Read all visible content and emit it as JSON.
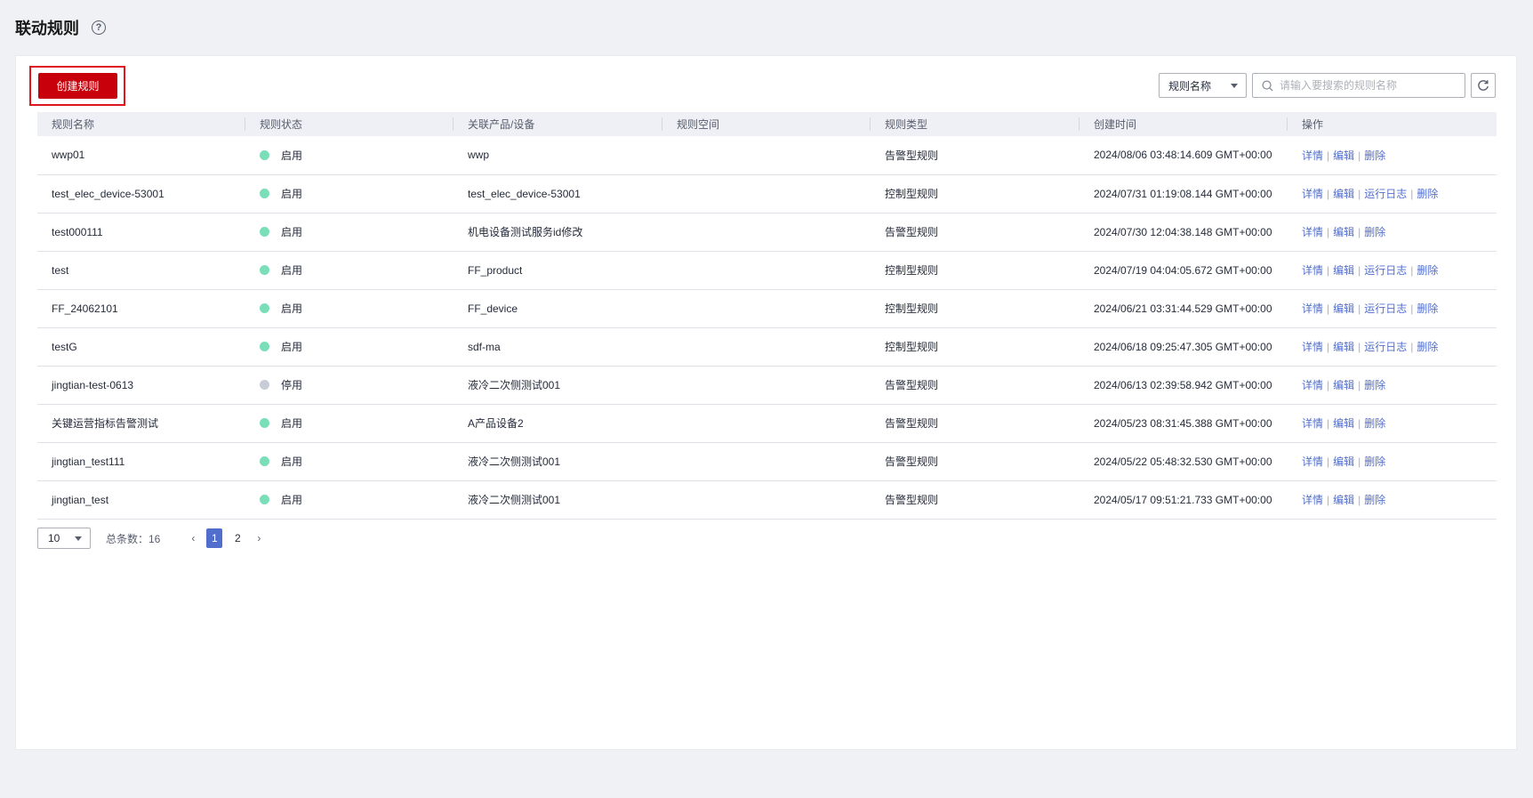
{
  "page": {
    "title": "联动规则"
  },
  "toolbar": {
    "create_label": "创建规则",
    "filter_selected": "规则名称",
    "search_placeholder": "请输入要搜索的规则名称"
  },
  "table": {
    "columns": [
      "规则名称",
      "规则状态",
      "关联产品/设备",
      "规则空间",
      "规则类型",
      "创建时间",
      "操作"
    ],
    "rows": [
      {
        "name": "wwp01",
        "status": "启用",
        "status_color": "#7adfb8",
        "product": "wwp",
        "space": "",
        "type": "告警型规则",
        "created": "2024/08/06 03:48:14.609 GMT+00:00",
        "ops": [
          "详情",
          "编辑",
          "删除"
        ]
      },
      {
        "name": "test_elec_device-53001",
        "status": "启用",
        "status_color": "#7adfb8",
        "product": "test_elec_device-53001",
        "space": "",
        "type": "控制型规则",
        "created": "2024/07/31 01:19:08.144 GMT+00:00",
        "ops": [
          "详情",
          "编辑",
          "运行日志",
          "删除"
        ]
      },
      {
        "name": "test000111",
        "status": "启用",
        "status_color": "#7adfb8",
        "product": "机电设备测试服务id修改",
        "space": "",
        "type": "告警型规则",
        "created": "2024/07/30 12:04:38.148 GMT+00:00",
        "ops": [
          "详情",
          "编辑",
          "删除"
        ]
      },
      {
        "name": "test",
        "status": "启用",
        "status_color": "#7adfb8",
        "product": "FF_product",
        "space": "",
        "type": "控制型规则",
        "created": "2024/07/19 04:04:05.672 GMT+00:00",
        "ops": [
          "详情",
          "编辑",
          "运行日志",
          "删除"
        ]
      },
      {
        "name": "FF_24062101",
        "status": "启用",
        "status_color": "#7adfb8",
        "product": "FF_device",
        "space": "",
        "type": "控制型规则",
        "created": "2024/06/21 03:31:44.529 GMT+00:00",
        "ops": [
          "详情",
          "编辑",
          "运行日志",
          "删除"
        ]
      },
      {
        "name": "testG",
        "status": "启用",
        "status_color": "#7adfb8",
        "product": "sdf-ma",
        "space": "",
        "type": "控制型规则",
        "created": "2024/06/18 09:25:47.305 GMT+00:00",
        "ops": [
          "详情",
          "编辑",
          "运行日志",
          "删除"
        ]
      },
      {
        "name": "jingtian-test-0613",
        "status": "停用",
        "status_color": "#c8ccd6",
        "product": "液冷二次侧测试001",
        "space": "",
        "type": "告警型规则",
        "created": "2024/06/13 02:39:58.942 GMT+00:00",
        "ops": [
          "详情",
          "编辑",
          "删除"
        ]
      },
      {
        "name": "关键运营指标告警测试",
        "status": "启用",
        "status_color": "#7adfb8",
        "product": "A产品设备2",
        "space": "",
        "type": "告警型规则",
        "created": "2024/05/23 08:31:45.388 GMT+00:00",
        "ops": [
          "详情",
          "编辑",
          "删除"
        ]
      },
      {
        "name": "jingtian_test111",
        "status": "启用",
        "status_color": "#7adfb8",
        "product": "液冷二次侧测试001",
        "space": "",
        "type": "告警型规则",
        "created": "2024/05/22 05:48:32.530 GMT+00:00",
        "ops": [
          "详情",
          "编辑",
          "删除"
        ]
      },
      {
        "name": "jingtian_test",
        "status": "启用",
        "status_color": "#7adfb8",
        "product": "液冷二次侧测试001",
        "space": "",
        "type": "告警型规则",
        "created": "2024/05/17 09:51:21.733 GMT+00:00",
        "ops": [
          "详情",
          "编辑",
          "删除"
        ]
      }
    ]
  },
  "pagination": {
    "page_size": "10",
    "total_label": "总条数：16",
    "pages": [
      "1",
      "2"
    ],
    "current_page": "1"
  },
  "colors": {
    "primary": "#c7000b",
    "link": "#526ecc",
    "enabled": "#7adfb8",
    "disabled": "#c8ccd6"
  }
}
